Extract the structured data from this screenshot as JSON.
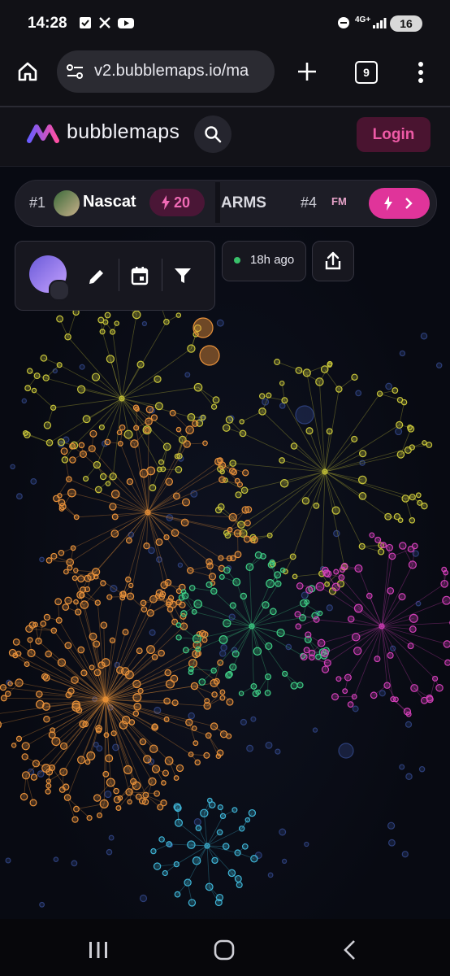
{
  "status_bar": {
    "time": "14:28",
    "network": "4G+",
    "battery": "16",
    "icons": [
      "checkbox-notification-icon",
      "x-app-icon",
      "youtube-icon",
      "do-not-disturb-icon",
      "signal-icon",
      "battery-icon"
    ]
  },
  "browser": {
    "url": "v2.bubblemaps.io/ma",
    "tab_count": "9",
    "icons": [
      "home-icon",
      "site-settings-icon",
      "new-tab-icon",
      "tabs-icon",
      "more-vert-icon"
    ]
  },
  "app": {
    "brand": "bubblemaps",
    "login_label": "Login",
    "accent_color": "#e0349a"
  },
  "ranking": {
    "first_rank": "#1",
    "first_name": "Nascat",
    "first_boost": "20",
    "second_name": "ARMS",
    "fourth_rank": "#4",
    "fourth_name_fragment": "FM"
  },
  "toolbar": {
    "last_update": "18h ago",
    "icons": [
      "edit-icon",
      "calendar-icon",
      "filter-icon",
      "share-icon"
    ]
  },
  "clusters": [
    {
      "color": "#e8913a",
      "label": "orange"
    },
    {
      "color": "#c9c63a",
      "label": "yellow"
    },
    {
      "color": "#3fcf86",
      "label": "green"
    },
    {
      "color": "#d23fb8",
      "label": "magenta"
    },
    {
      "color": "#3fb6d8",
      "label": "cyan"
    }
  ]
}
